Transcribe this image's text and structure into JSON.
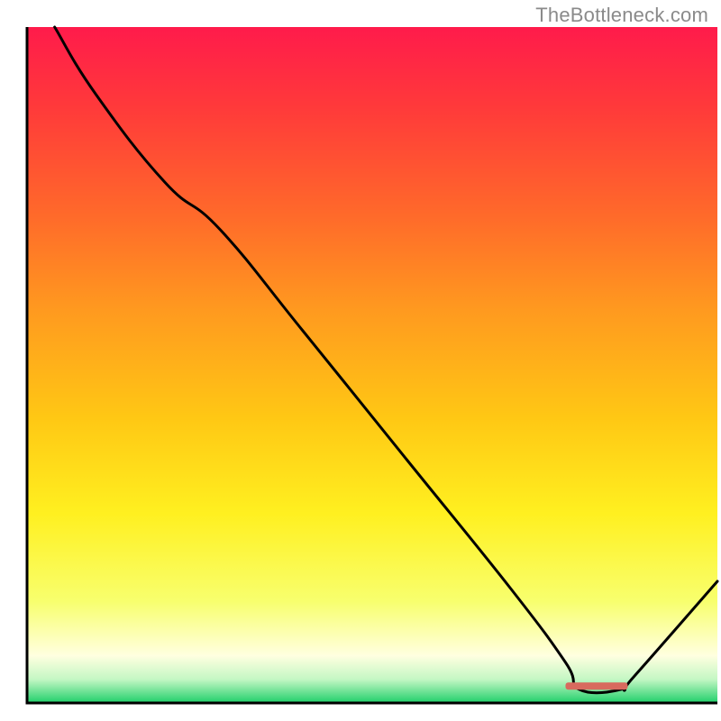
{
  "attribution": "TheBottleneck.com",
  "chart_data": {
    "type": "line",
    "title": "",
    "xlabel": "",
    "ylabel": "",
    "xlim": [
      0,
      100
    ],
    "ylim": [
      0,
      100
    ],
    "background": "rainbow-vertical-red-to-green",
    "series": [
      {
        "name": "curve",
        "color": "#000000",
        "x": [
          4,
          10,
          20,
          28,
          40,
          55,
          70,
          78,
          80,
          86,
          88,
          100
        ],
        "y": [
          100,
          90,
          77,
          70,
          55,
          36,
          17,
          6,
          2,
          2,
          4,
          18
        ]
      }
    ],
    "marker": {
      "name": "highlight-segment",
      "color": "#d86a5e",
      "x_start": 78,
      "x_end": 87,
      "y": 2.5
    },
    "gradient_stops": [
      {
        "offset": 0.0,
        "color": "#ff1b4b"
      },
      {
        "offset": 0.12,
        "color": "#ff3a3a"
      },
      {
        "offset": 0.28,
        "color": "#ff6a2a"
      },
      {
        "offset": 0.42,
        "color": "#ff9a1f"
      },
      {
        "offset": 0.58,
        "color": "#ffc814"
      },
      {
        "offset": 0.72,
        "color": "#fff020"
      },
      {
        "offset": 0.85,
        "color": "#f8ff6e"
      },
      {
        "offset": 0.93,
        "color": "#ffffe0"
      },
      {
        "offset": 0.965,
        "color": "#c4f7c4"
      },
      {
        "offset": 1.0,
        "color": "#1fcf6a"
      }
    ]
  }
}
